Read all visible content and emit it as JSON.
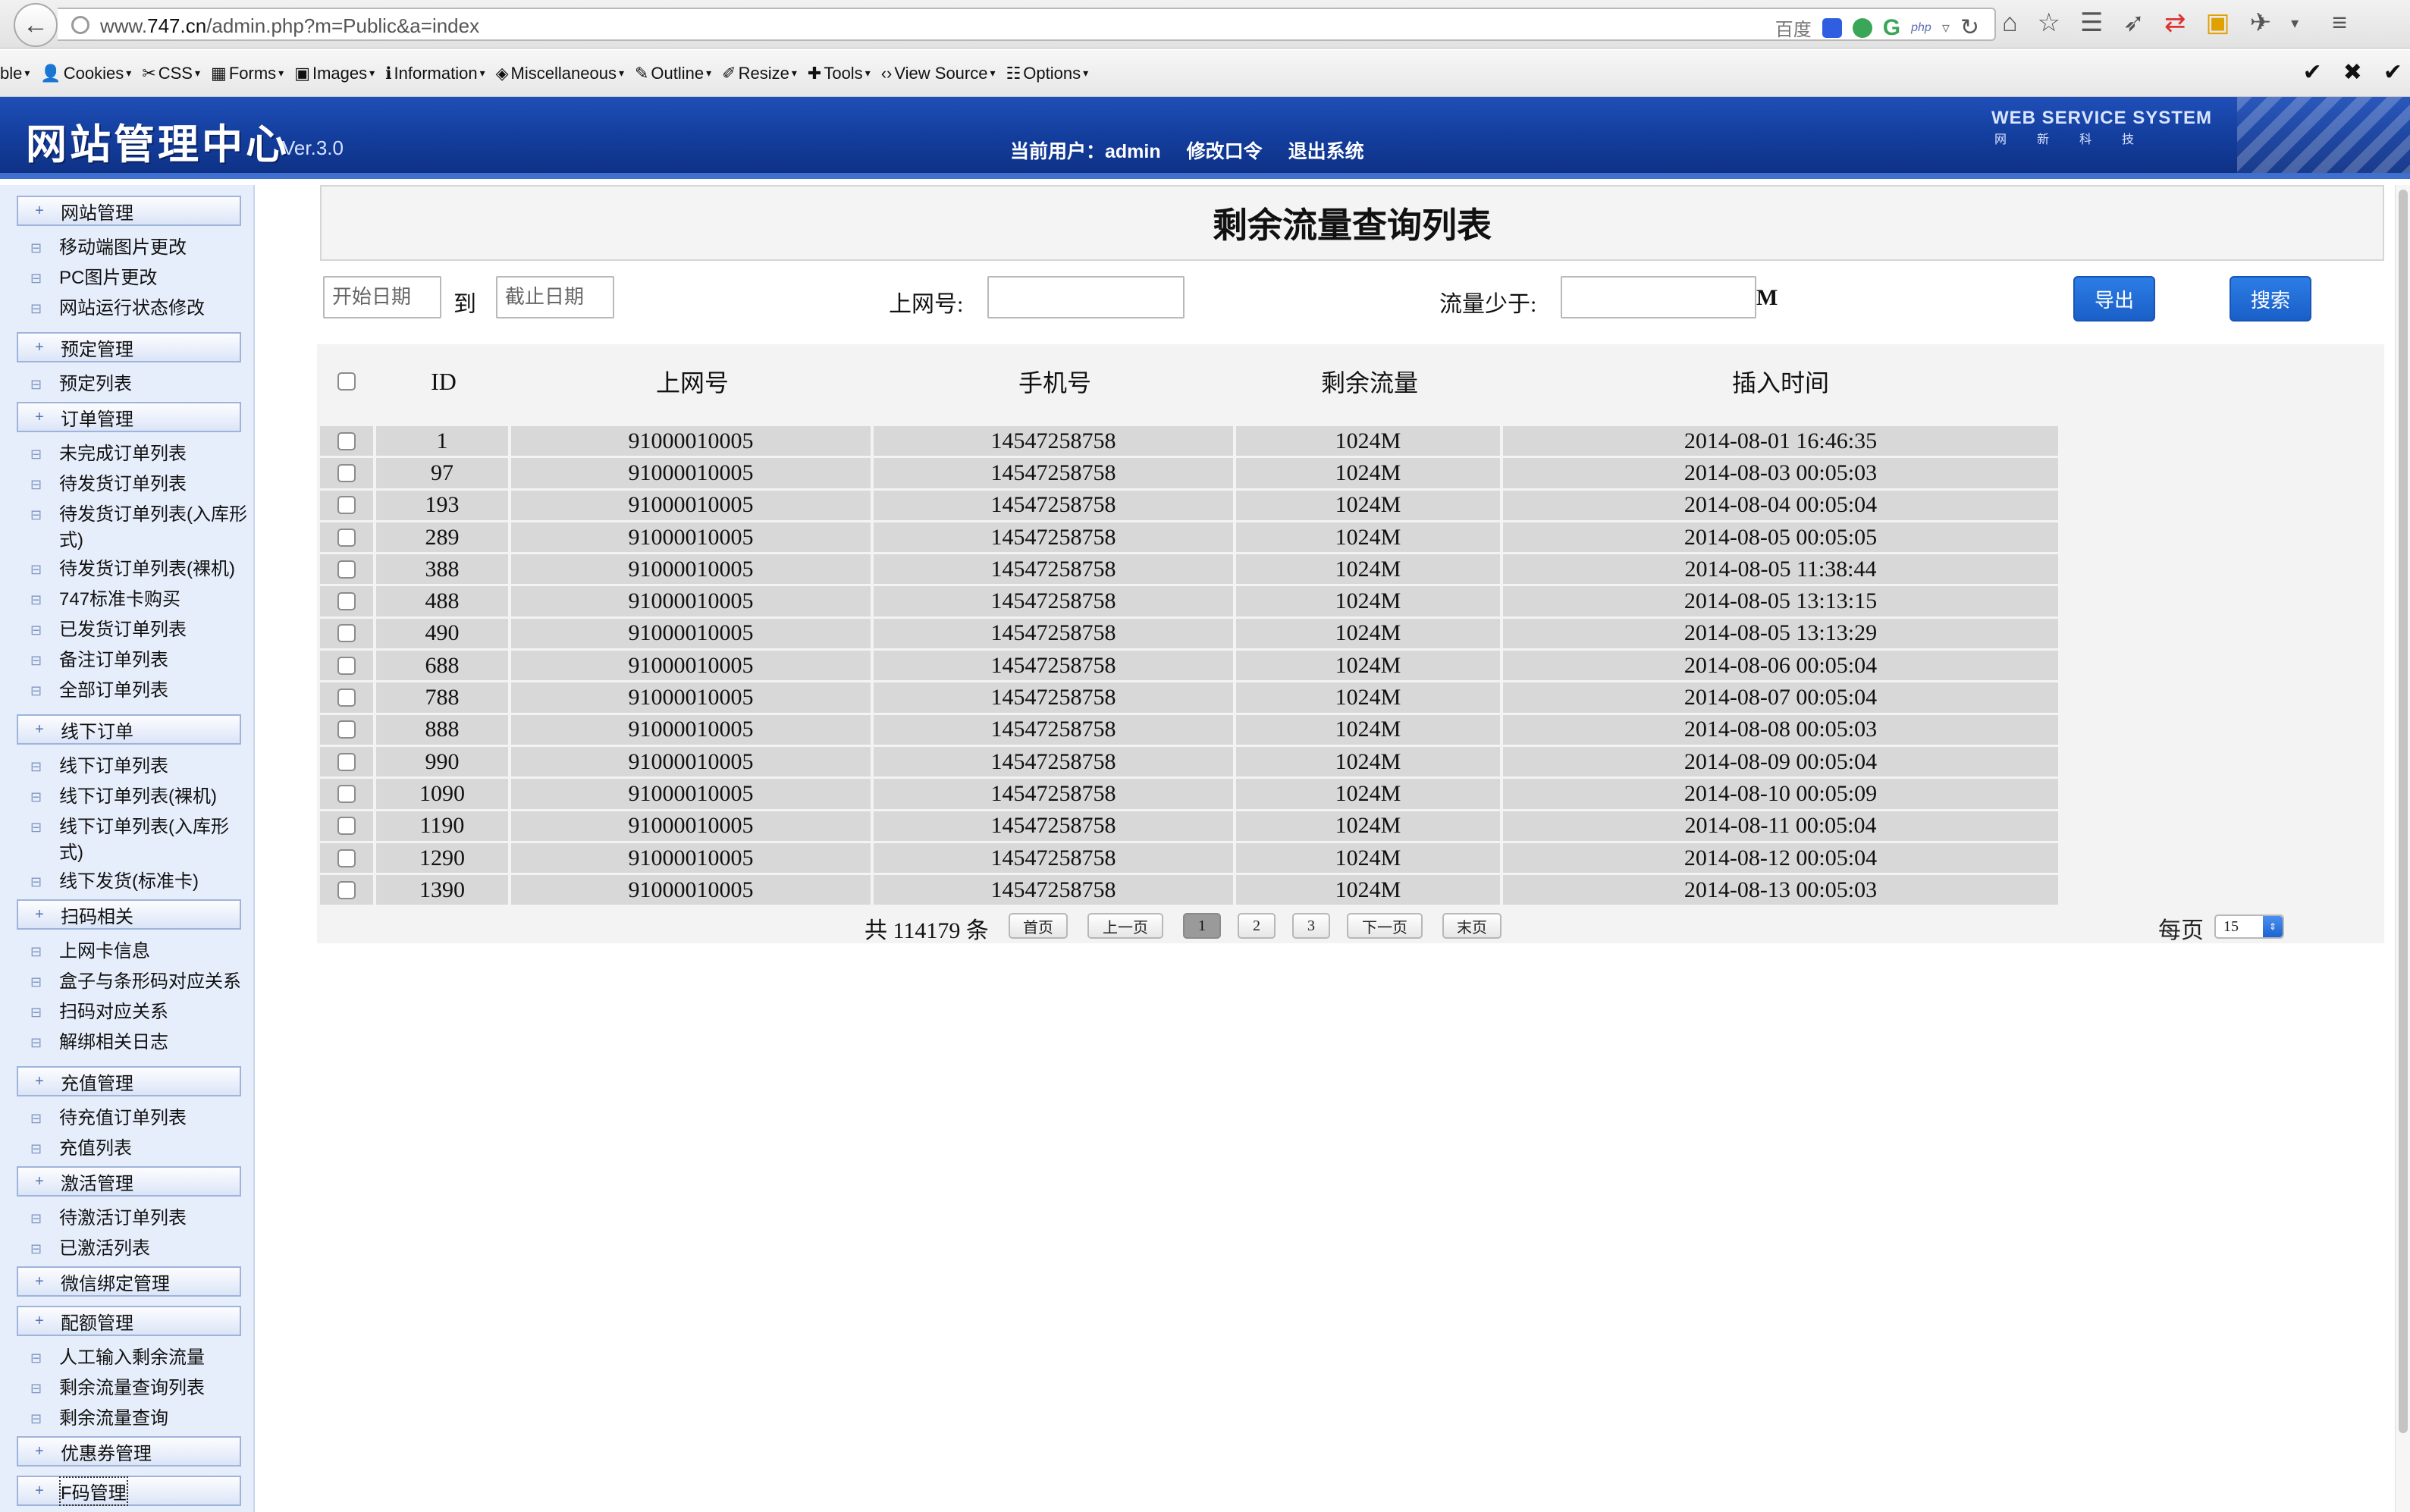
{
  "browser": {
    "url_prefix": "www.",
    "url_host": "747.cn",
    "url_path": "/admin.php?m=Public&a=index",
    "search_engine": "百度",
    "search_php": "php"
  },
  "webdev": {
    "items": [
      {
        "icon": "",
        "label": "ble"
      },
      {
        "icon": "👤",
        "label": "Cookies"
      },
      {
        "icon": "✂",
        "label": "CSS"
      },
      {
        "icon": "▦",
        "label": "Forms"
      },
      {
        "icon": "▣",
        "label": "Images"
      },
      {
        "icon": "ℹ",
        "label": "Information"
      },
      {
        "icon": "◈",
        "label": "Miscellaneous"
      },
      {
        "icon": "✎",
        "label": "Outline"
      },
      {
        "icon": "✐",
        "label": "Resize"
      },
      {
        "icon": "✚",
        "label": "Tools"
      },
      {
        "icon": "‹›",
        "label": "View Source"
      },
      {
        "icon": "☷",
        "label": "Options"
      }
    ]
  },
  "header": {
    "title": "网站管理中心",
    "version": "Ver.3.0",
    "user_label": "当前用户：admin",
    "change_password": "修改口令",
    "logout": "退出系统",
    "brand_title": "WEB SERVICE SYSTEM",
    "brand_sub": "网新科技"
  },
  "sidebar": {
    "g1": "网站管理",
    "g1_items": [
      "移动端图片更改",
      "PC图片更改",
      "网站运行状态修改"
    ],
    "g2": "预定管理",
    "g2_items": [
      "预定列表"
    ],
    "g3": "订单管理",
    "g3_items": [
      "未完成订单列表",
      "待发货订单列表",
      "待发货订单列表(入库形式)",
      "待发货订单列表(裸机)",
      "747标准卡购买",
      "已发货订单列表",
      "备注订单列表",
      "全部订单列表"
    ],
    "g4": "线下订单",
    "g4_items": [
      "线下订单列表",
      "线下订单列表(裸机)",
      "线下订单列表(入库形式)",
      "线下发货(标准卡)"
    ],
    "g5": "扫码相关",
    "g5_items": [
      "上网卡信息",
      "盒子与条形码对应关系",
      "扫码对应关系",
      "解绑相关日志"
    ],
    "g6": "充值管理",
    "g6_items": [
      "待充值订单列表",
      "充值列表"
    ],
    "g7": "激活管理",
    "g7_items": [
      "待激活订单列表",
      "已激活列表"
    ],
    "g8": "微信绑定管理",
    "g9": "配额管理",
    "g9_items": [
      "人工输入剩余流量",
      "剩余流量查询列表",
      "剩余流量查询"
    ],
    "g10": "优惠券管理",
    "g11": "F码管理"
  },
  "main": {
    "title": "剩余流量查询列表",
    "filters": {
      "start_placeholder": "开始日期",
      "to_label": "到",
      "end_placeholder": "截止日期",
      "net_label": "上网号:",
      "flow_label": "流量少于:",
      "flow_unit": "M",
      "export_button": "导出",
      "search_button": "搜索"
    },
    "table": {
      "headers": [
        "ID",
        "上网号",
        "手机号",
        "剩余流量",
        "插入时间"
      ],
      "rows": [
        [
          "1",
          "91000010005",
          "14547258758",
          "1024M",
          "2014-08-01 16:46:35"
        ],
        [
          "97",
          "91000010005",
          "14547258758",
          "1024M",
          "2014-08-03 00:05:03"
        ],
        [
          "193",
          "91000010005",
          "14547258758",
          "1024M",
          "2014-08-04 00:05:04"
        ],
        [
          "289",
          "91000010005",
          "14547258758",
          "1024M",
          "2014-08-05 00:05:05"
        ],
        [
          "388",
          "91000010005",
          "14547258758",
          "1024M",
          "2014-08-05 11:38:44"
        ],
        [
          "488",
          "91000010005",
          "14547258758",
          "1024M",
          "2014-08-05 13:13:15"
        ],
        [
          "490",
          "91000010005",
          "14547258758",
          "1024M",
          "2014-08-05 13:13:29"
        ],
        [
          "688",
          "91000010005",
          "14547258758",
          "1024M",
          "2014-08-06 00:05:04"
        ],
        [
          "788",
          "91000010005",
          "14547258758",
          "1024M",
          "2014-08-07 00:05:04"
        ],
        [
          "888",
          "91000010005",
          "14547258758",
          "1024M",
          "2014-08-08 00:05:03"
        ],
        [
          "990",
          "91000010005",
          "14547258758",
          "1024M",
          "2014-08-09 00:05:04"
        ],
        [
          "1090",
          "91000010005",
          "14547258758",
          "1024M",
          "2014-08-10 00:05:09"
        ],
        [
          "1190",
          "91000010005",
          "14547258758",
          "1024M",
          "2014-08-11 00:05:04"
        ],
        [
          "1290",
          "91000010005",
          "14547258758",
          "1024M",
          "2014-08-12 00:05:04"
        ],
        [
          "1390",
          "91000010005",
          "14547258758",
          "1024M",
          "2014-08-13 00:05:03"
        ]
      ]
    },
    "pager": {
      "total": "共 114179 条",
      "first": "首页",
      "prev": "上一页",
      "pages": [
        "1",
        "2",
        "3"
      ],
      "next": "下一页",
      "last": "末页",
      "per_page_label": "每页",
      "per_page_value": "15"
    }
  },
  "colors": {
    "header_blue": "#143f9f",
    "button_blue": "#1a5fc8",
    "row_gray": "#d8d8d8",
    "sidebar_bg": "#e7eefb"
  }
}
